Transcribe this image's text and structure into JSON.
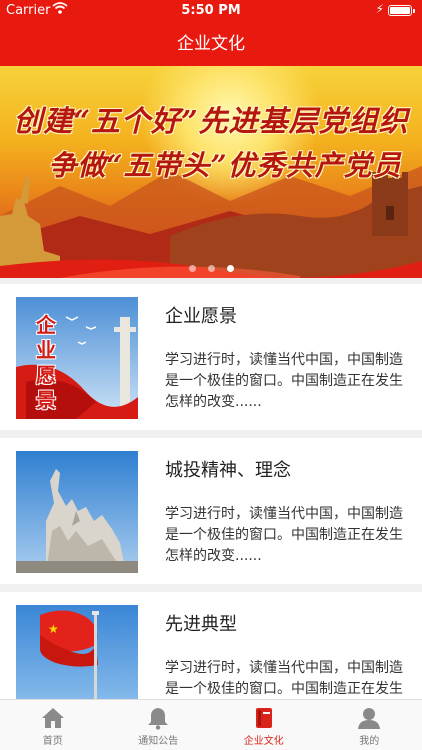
{
  "status": {
    "carrier": "Carrier",
    "time": "5:50 PM"
  },
  "nav": {
    "title": "企业文化"
  },
  "banner": {
    "line1": "创建“五个好”先进基层党组织",
    "line2": "争做“五带头”优秀共产党员",
    "slide_count": 3,
    "active_slide": 3
  },
  "items": [
    {
      "title": "企业愿景",
      "desc": "学习进行时，读懂当代中国，中国制造是一个极佳的窗口。中国制造正在发生怎样的改变......",
      "thumb_text": "企业愿景"
    },
    {
      "title": "城投精神、理念",
      "desc": "学习进行时，读懂当代中国，中国制造是一个极佳的窗口。中国制造正在发生怎样的改变......"
    },
    {
      "title": "先进典型",
      "desc": "学习进行时，读懂当代中国，中国制造是一个极佳的窗口。中国制造正在发生怎样的改变......"
    }
  ],
  "tabs": [
    {
      "label": "首页",
      "icon": "home-icon"
    },
    {
      "label": "通知公告",
      "icon": "bell-icon"
    },
    {
      "label": "企业文化",
      "icon": "book-icon",
      "active": true
    },
    {
      "label": "我的",
      "icon": "user-icon"
    }
  ],
  "colors": {
    "primary": "#e8190f",
    "tab_active": "#d8241b",
    "tab_inactive": "#8a8a8a"
  }
}
